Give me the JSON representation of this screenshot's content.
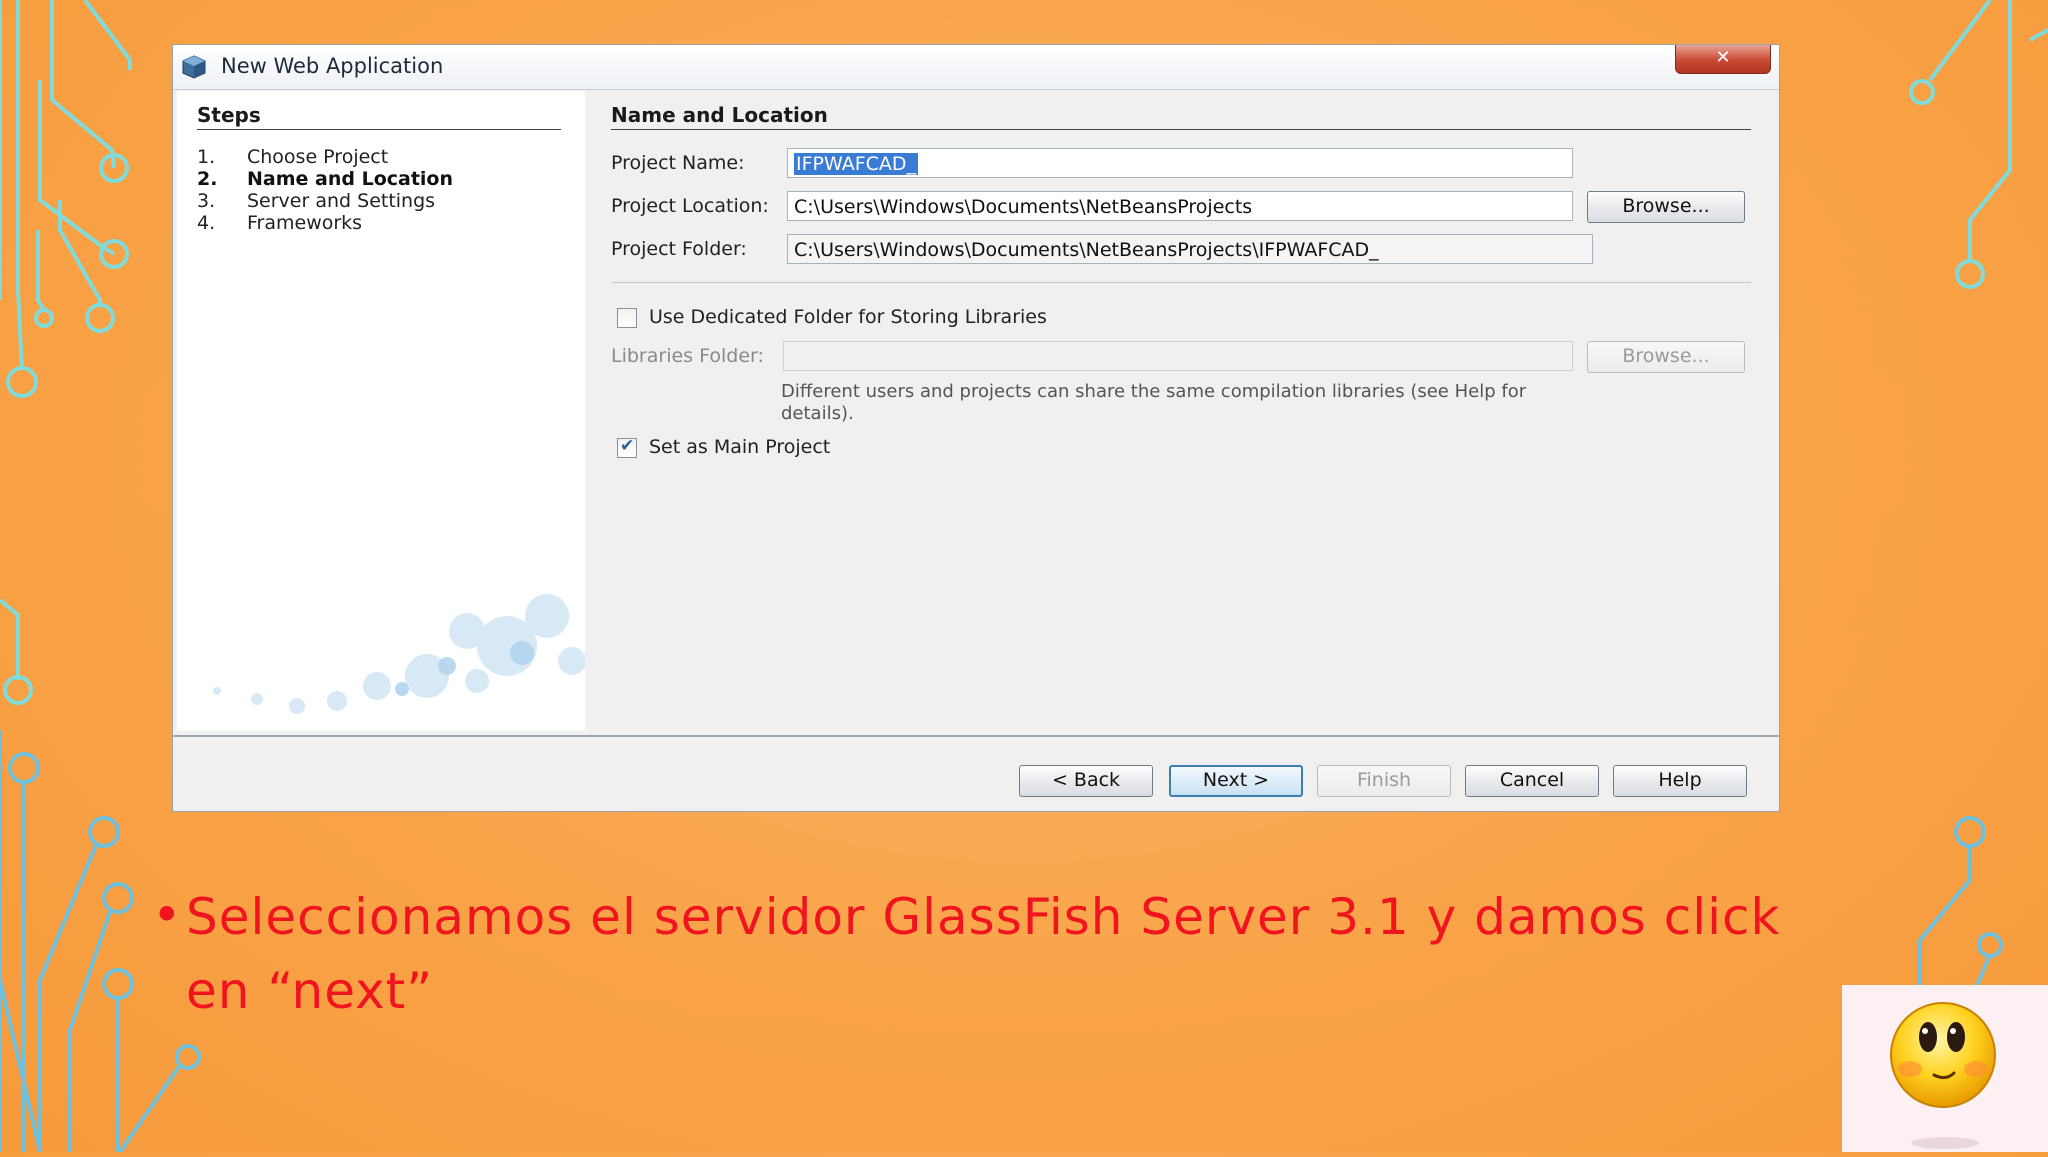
{
  "window": {
    "title": "New Web Application",
    "close_label": "✕"
  },
  "steps": {
    "heading": "Steps",
    "items": [
      {
        "num": "1.",
        "label": "Choose Project",
        "active": false
      },
      {
        "num": "2.",
        "label": "Name and Location",
        "active": true
      },
      {
        "num": "3.",
        "label": "Server and Settings",
        "active": false
      },
      {
        "num": "4.",
        "label": "Frameworks",
        "active": false
      }
    ]
  },
  "main": {
    "heading": "Name and Location",
    "project_name_label": "Project Name:",
    "project_name_value": "IFPWAFCAD_",
    "project_location_label": "Project Location:",
    "project_location_value": "C:\\Users\\Windows\\Documents\\NetBeansProjects",
    "browse_label": "Browse...",
    "project_folder_label": "Project Folder:",
    "project_folder_value": "C:\\Users\\Windows\\Documents\\NetBeansProjects\\IFPWAFCAD_",
    "dedicated_folder_label": "Use Dedicated Folder for Storing Libraries",
    "dedicated_folder_checked": false,
    "libraries_folder_label": "Libraries Folder:",
    "libraries_folder_value": "",
    "libraries_browse_label": "Browse...",
    "libraries_note": "Different users and projects can share the same compilation libraries (see Help for details).",
    "main_project_label": "Set as Main Project",
    "main_project_checked": true
  },
  "footer": {
    "back": "< Back",
    "next": "Next >",
    "finish": "Finish",
    "cancel": "Cancel",
    "help": "Help"
  },
  "slide": {
    "bullet": "•",
    "text": "Seleccionamos el servidor GlassFish Server 3.1 y damos click en “next”"
  },
  "colors": {
    "background": "#f9a348",
    "circuit": "#7fe0e0",
    "bullet_text": "#f0141e",
    "selection": "#3a7bd5"
  }
}
